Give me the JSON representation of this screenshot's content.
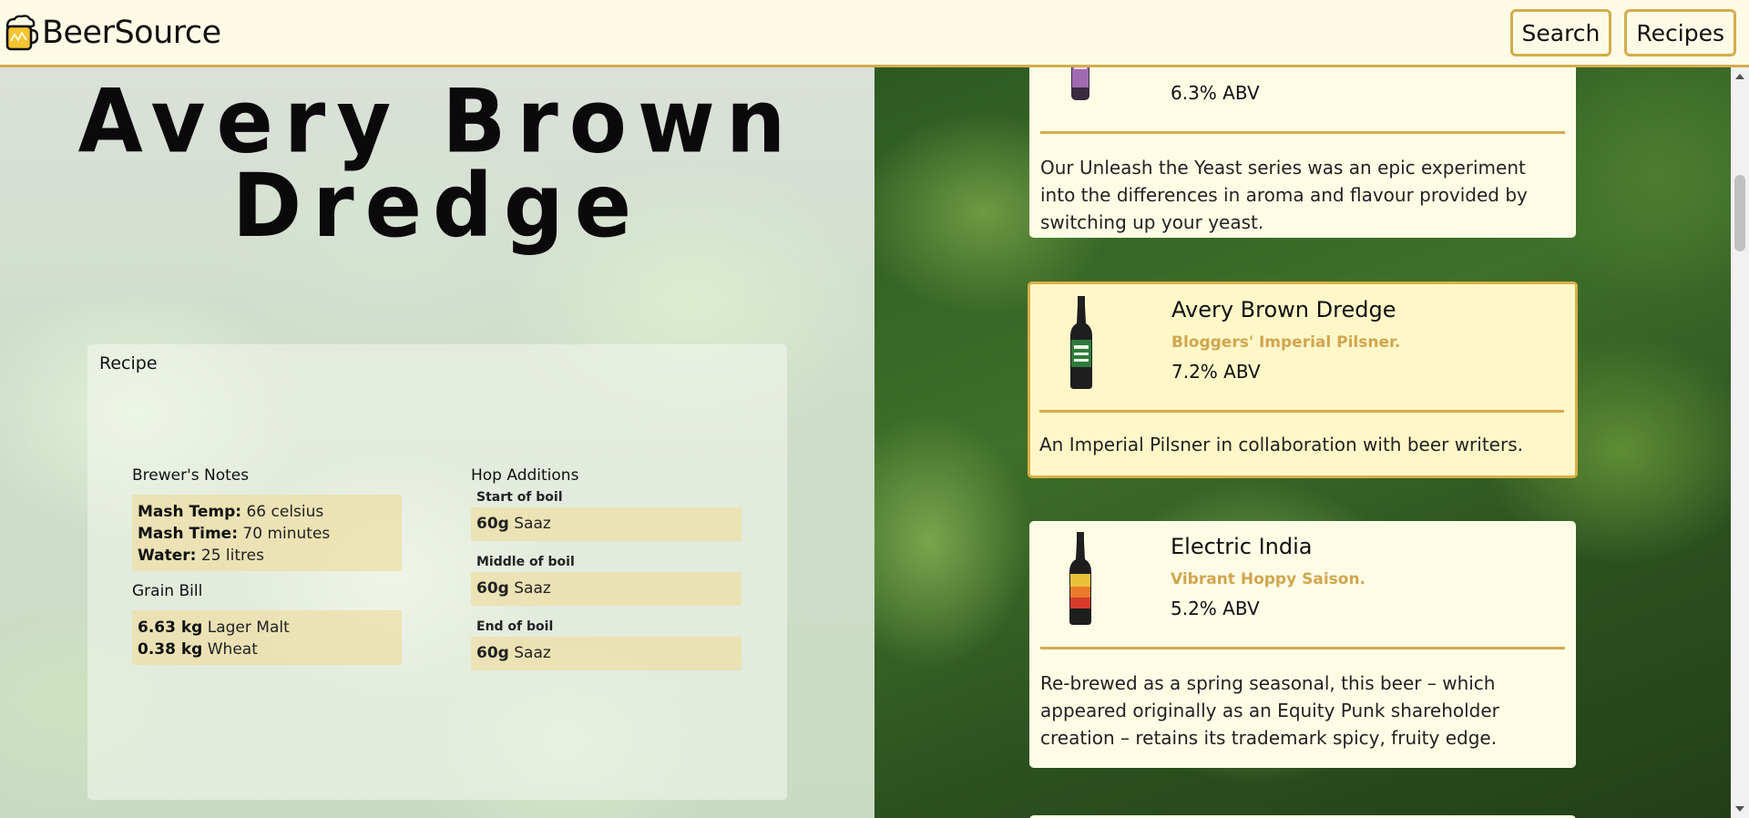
{
  "header": {
    "brand": "BeerSource",
    "brand_icon": "beer-mug-icon",
    "nav": {
      "search": "Search",
      "recipes": "Recipes"
    }
  },
  "detail": {
    "title": "Avery Brown Dredge",
    "recipe": {
      "heading": "Recipe",
      "brewers_notes": {
        "title": "Brewer's Notes",
        "mash_temp": {
          "label": "Mash Temp:",
          "value": "66 celsius"
        },
        "mash_time": {
          "label": "Mash Time:",
          "value": "70 minutes"
        },
        "water": {
          "label": "Water:",
          "value": "25 litres"
        }
      },
      "grain_bill": {
        "title": "Grain Bill",
        "items": [
          {
            "amount": "6.63 kg",
            "name": "Lager Malt"
          },
          {
            "amount": "0.38 kg",
            "name": "Wheat"
          }
        ]
      },
      "hop_additions": {
        "title": "Hop Additions",
        "items": [
          {
            "stage": "Start of boil",
            "amount": "60g",
            "name": "Saaz"
          },
          {
            "stage": "Middle of boil",
            "amount": "60g",
            "name": "Saaz"
          },
          {
            "stage": "End of boil",
            "amount": "60g",
            "name": "Saaz"
          }
        ]
      }
    }
  },
  "beer_list": [
    {
      "abv": "6.3% ABV",
      "description": "Our Unleash the Yeast series was an epic experiment into the differences in aroma and flavour provided by switching up your yeast."
    },
    {
      "name": "Avery Brown Dredge",
      "tagline": "Bloggers' Imperial Pilsner.",
      "abv": "7.2% ABV",
      "description": "An Imperial Pilsner in collaboration with beer writers.",
      "selected": true
    },
    {
      "name": "Electric India",
      "tagline": "Vibrant Hoppy Saison.",
      "abv": "5.2% ABV",
      "description": "Re-brewed as a spring seasonal, this beer – which appeared originally as an Equity Punk shareholder creation – retains its trademark spicy, fruity edge."
    }
  ],
  "colors": {
    "accent": "#d4ac4c",
    "tagline": "#d1a64f",
    "header_bg": "#fdfbe6",
    "card_bg": "#fffce6",
    "selected_card_bg": "#fff7c8"
  }
}
